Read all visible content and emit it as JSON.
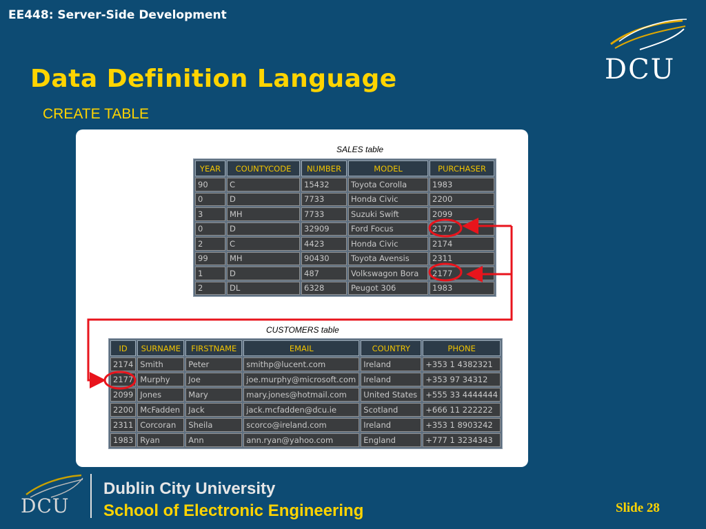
{
  "header": {
    "course": "EE448: Server-Side Development",
    "title": "Data Definition Language",
    "subtitle": "CREATE TABLE"
  },
  "logo": {
    "text": "DCU"
  },
  "sales": {
    "caption": "SALES table",
    "columns": [
      "YEAR",
      "COUNTYCODE",
      "NUMBER",
      "MODEL",
      "PURCHASER"
    ],
    "rows": [
      [
        "90",
        "C",
        "15432",
        "Toyota Corolla",
        "1983"
      ],
      [
        "0",
        "D",
        "7733",
        "Honda Civic",
        "2200"
      ],
      [
        "3",
        "MH",
        "7733",
        "Suzuki Swift",
        "2099"
      ],
      [
        "0",
        "D",
        "32909",
        "Ford Focus",
        "2177"
      ],
      [
        "2",
        "C",
        "4423",
        "Honda Civic",
        "2174"
      ],
      [
        "99",
        "MH",
        "90430",
        "Toyota Avensis",
        "2311"
      ],
      [
        "1",
        "D",
        "487",
        "Volkswagon Bora",
        "2177"
      ],
      [
        "2",
        "DL",
        "6328",
        "Peugot 306",
        "1983"
      ]
    ]
  },
  "customers": {
    "caption": "CUSTOMERS table",
    "columns": [
      "ID",
      "SURNAME",
      "FIRSTNAME",
      "EMAIL",
      "COUNTRY",
      "PHONE"
    ],
    "rows": [
      [
        "2174",
        "Smith",
        "Peter",
        "smithp@lucent.com",
        "Ireland",
        "+353 1 4382321"
      ],
      [
        "2177",
        "Murphy",
        "Joe",
        "joe.murphy@microsoft.com",
        "Ireland",
        "+353 97 34312"
      ],
      [
        "2099",
        "Jones",
        "Mary",
        "mary.jones@hotmail.com",
        "United States",
        "+555 33 4444444"
      ],
      [
        "2200",
        "McFadden",
        "Jack",
        "jack.mcfadden@dcu.ie",
        "Scotland",
        "+666 11 222222"
      ],
      [
        "2311",
        "Corcoran",
        "Sheila",
        "scorco@ireland.com",
        "Ireland",
        "+353 1 8903242"
      ],
      [
        "1983",
        "Ryan",
        "Ann",
        "ann.ryan@yahoo.com",
        "England",
        "+777 1 3234343"
      ]
    ]
  },
  "annotation": {
    "color": "#e8141c"
  },
  "footer": {
    "logo_text": "DCU",
    "university": "Dublin City University",
    "school": "School of Electronic Engineering",
    "slide": "Slide 28"
  }
}
